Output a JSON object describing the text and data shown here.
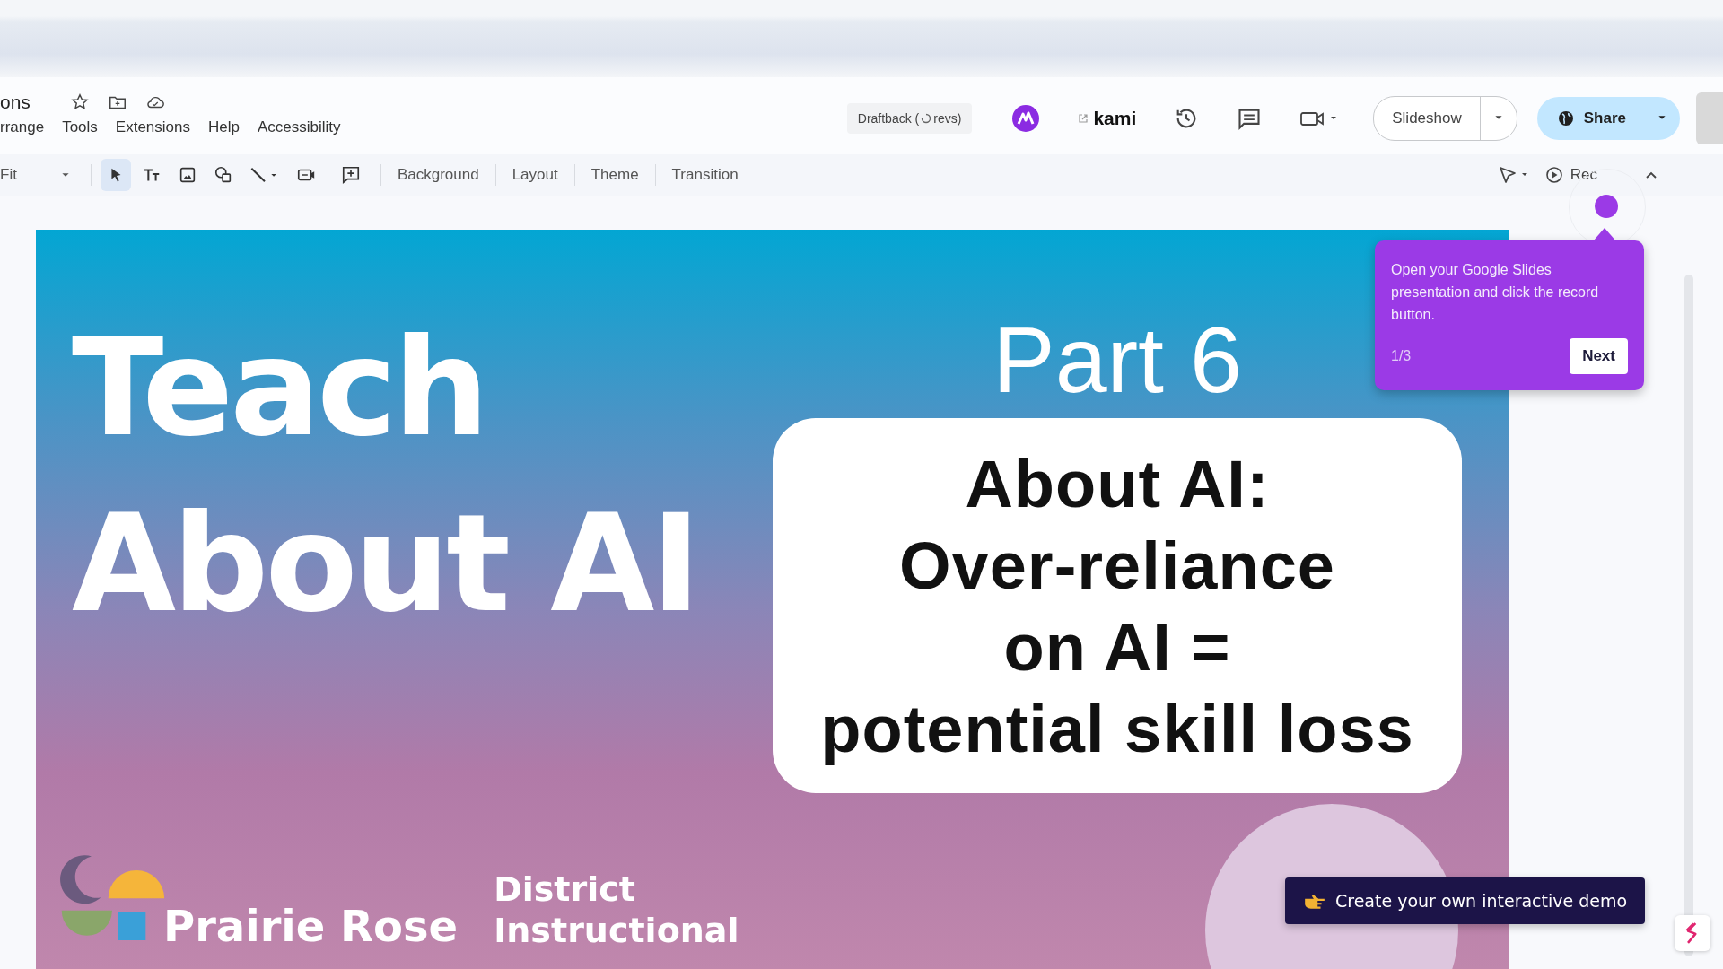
{
  "header": {
    "title": "ons",
    "menu": [
      "rrange",
      "Tools",
      "Extensions",
      "Help",
      "Accessibility"
    ],
    "draftback": {
      "prefix": "Draftback (",
      "suffix": "revs)"
    },
    "kami": "kami",
    "slideshow": "Slideshow",
    "share": "Share"
  },
  "toolbar": {
    "zoom": "Fit",
    "tools": [
      {
        "kind": "select",
        "selected": true
      },
      {
        "kind": "text",
        "selected": false
      },
      {
        "kind": "image",
        "selected": false
      },
      {
        "kind": "shape",
        "selected": false
      },
      {
        "kind": "line",
        "selected": false
      },
      {
        "kind": "video",
        "selected": false
      },
      {
        "kind": "comment",
        "selected": false
      }
    ],
    "buttons": [
      "Background",
      "Layout",
      "Theme",
      "Transition"
    ],
    "rec": "Rec"
  },
  "slide": {
    "title": "Teach\nAbout AI",
    "part": "Part 6",
    "callout": "About AI:\nOver-reliance\non AI =\npotential skill loss",
    "org": "Prairie Rose",
    "org_sub": "District\nInstructional"
  },
  "tooltip": {
    "text": "Open your Google Slides presentation and click the record button.",
    "step": "1/3",
    "next": "Next"
  },
  "cta": "Create your own interactive demo"
}
